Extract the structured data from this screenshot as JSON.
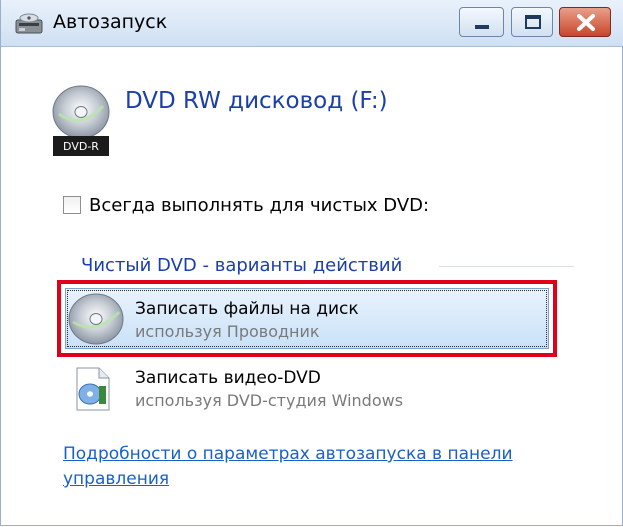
{
  "window": {
    "title": "Автозапуск",
    "icon": "autoplay-icon"
  },
  "caption_buttons": {
    "minimize_icon": "minimize-icon",
    "maximize_icon": "maximize-icon",
    "close_icon": "close-icon"
  },
  "device": {
    "title": "DVD RW дисковод (F:)",
    "icon": "dvd-drive-icon",
    "icon_badge": "DVD-R"
  },
  "always_checkbox": {
    "label": "Всегда выполнять для чистых DVD:",
    "checked": false
  },
  "section": {
    "label": "Чистый DVD - варианты действий"
  },
  "options": [
    {
      "title": "Записать файлы на диск",
      "subtitle": "используя Проводник",
      "icon": "disc-burn-icon",
      "selected": true
    },
    {
      "title": "Записать видео-DVD",
      "subtitle": "используя DVD-студия Windows",
      "icon": "dvd-studio-icon",
      "selected": false
    }
  ],
  "help_link": {
    "text": "Подробности о параметрах автозапуска в панели управления"
  },
  "colors": {
    "link": "#1a60c8",
    "highlight_border": "#e0001a",
    "close_button": "#c9452a"
  }
}
